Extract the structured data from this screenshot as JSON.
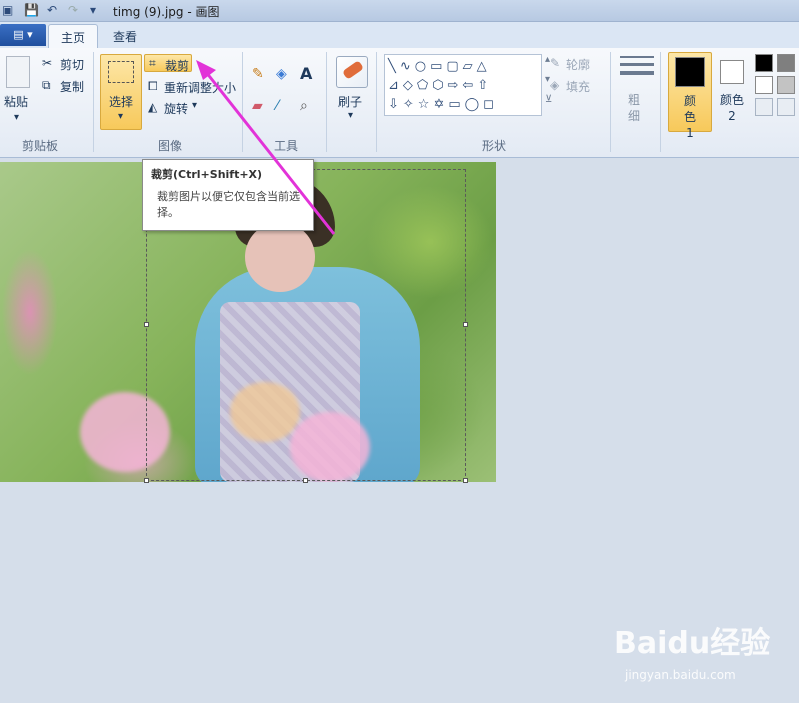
{
  "window": {
    "title": "timg (9).jpg - 画图"
  },
  "tabs": {
    "home": "主页",
    "view": "查看"
  },
  "clipboard": {
    "paste": "粘贴",
    "cut": "剪切",
    "copy": "复制",
    "group": "剪贴板"
  },
  "image": {
    "select": "选择",
    "crop": "裁剪",
    "resize": "重新调整大小",
    "rotate": "旋转",
    "group": "图像"
  },
  "tools": {
    "group": "工具"
  },
  "brush": {
    "label": "刷子"
  },
  "shapes": {
    "outline": "轮廓",
    "fill": "填充",
    "group": "形状"
  },
  "size": {
    "label": "粗细"
  },
  "colors": {
    "color1": "颜色 1",
    "color2": "颜色 2",
    "primary": "#000000",
    "secondary": "#ffffff"
  },
  "tooltip": {
    "title": "裁剪(Ctrl+Shift+X)",
    "body": "裁剪图片以便它仅包含当前选择。"
  },
  "watermark": {
    "brand": "Baidu经验",
    "url": "jingyan.baidu.com"
  },
  "icons": [
    "save-icon",
    "undo-icon",
    "redo-icon",
    "scissors-icon",
    "copy-icon",
    "crop-icon",
    "resize-icon",
    "rotate-icon",
    "pencil-icon",
    "fill-icon",
    "text-icon",
    "eraser-icon",
    "color-picker-icon",
    "magnifier-icon",
    "brush-icon"
  ]
}
